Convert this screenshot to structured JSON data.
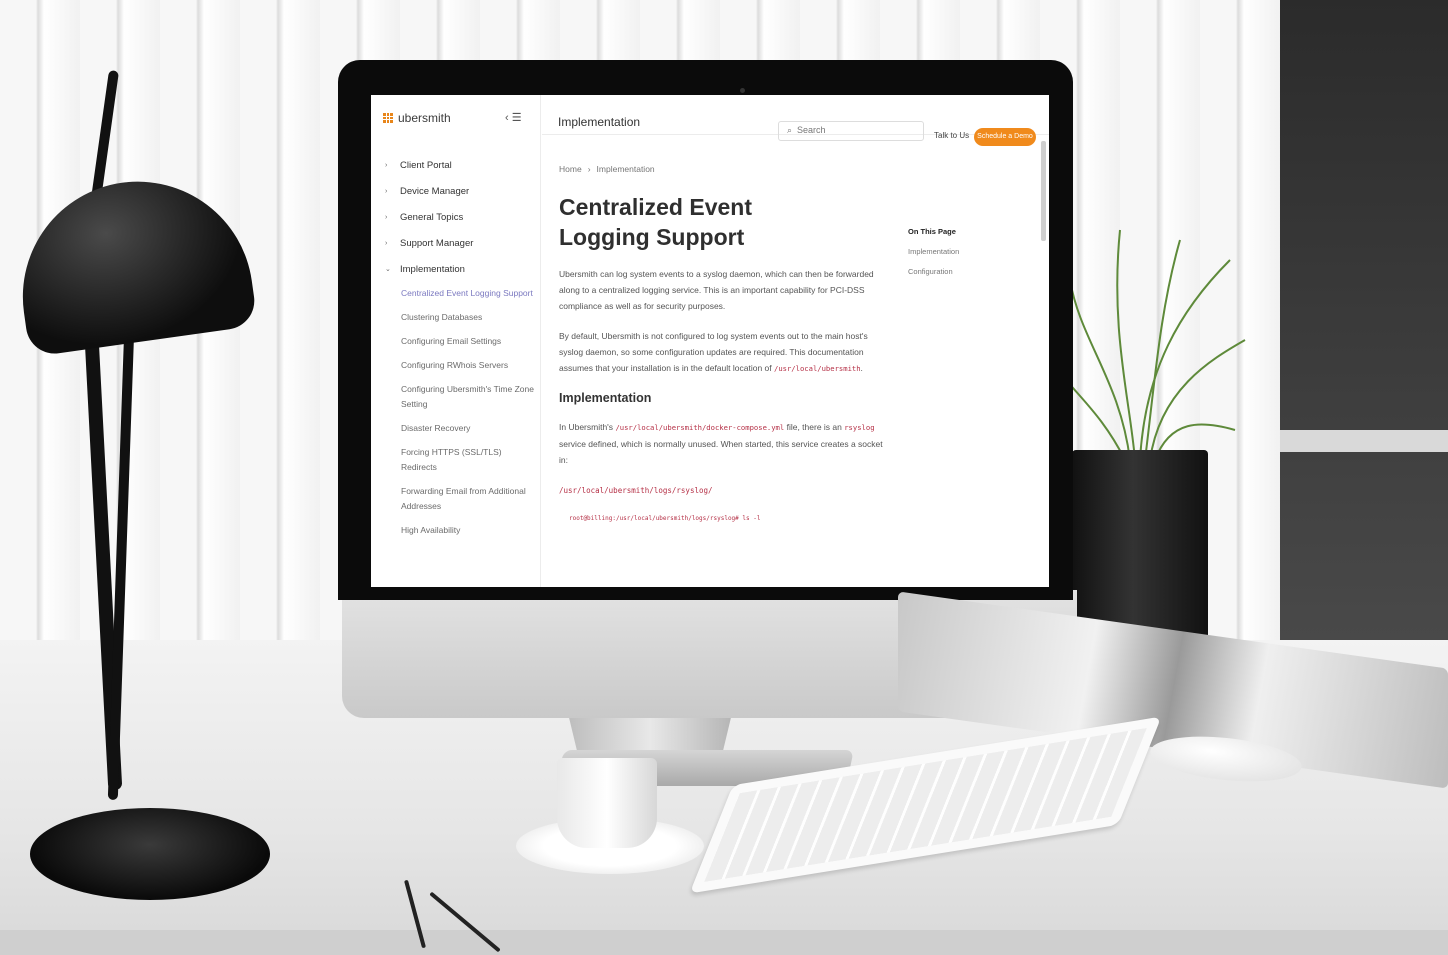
{
  "brand": {
    "name": "ubersmith"
  },
  "sidebar": {
    "collapse_label": "‹ ☰",
    "items": [
      {
        "label": "Client Portal",
        "expanded": false
      },
      {
        "label": "Device Manager",
        "expanded": false
      },
      {
        "label": "General Topics",
        "expanded": false
      },
      {
        "label": "Support Manager",
        "expanded": false
      },
      {
        "label": "Implementation",
        "expanded": true
      }
    ],
    "subitems": [
      {
        "label": "Centralized Event Logging Support",
        "active": true
      },
      {
        "label": "Clustering Databases"
      },
      {
        "label": "Configuring Email Settings"
      },
      {
        "label": "Configuring RWhois Servers"
      },
      {
        "label": "Configuring Ubersmith's Time Zone Setting"
      },
      {
        "label": "Disaster Recovery"
      },
      {
        "label": "Forcing HTTPS (SSL/TLS) Redirects"
      },
      {
        "label": "Forwarding Email from Additional Addresses"
      },
      {
        "label": "High Availability"
      }
    ]
  },
  "header": {
    "title": "Implementation",
    "search_placeholder": "Search",
    "talk_label": "Talk to Us",
    "demo_label": "Schedule a Demo"
  },
  "breadcrumb": {
    "home": "Home",
    "separator": "›",
    "current": "Implementation"
  },
  "article": {
    "title": "Centralized Event Logging Support",
    "p1": "Ubersmith can log system events to a syslog daemon, which can then be forwarded along to a centralized logging service. This is an important capability for PCI-DSS compliance as well as for security purposes.",
    "p2_text": "By default, Ubersmith is not configured to log system events out to the main host's syslog daemon, so some configuration updates are required. This documentation assumes that your installation is in the default location of",
    "p2_code": "/usr/local/ubersmith",
    "p2_end": ".",
    "section_heading": "Implementation",
    "p3_start": "In Ubersmith's",
    "p3_code": "/usr/local/ubersmith/docker-compose.yml",
    "p3_mid": "file, there is an",
    "p3_code2": "rsyslog",
    "p3_end": "service defined, which is normally unused. When started, this service creates a socket in:",
    "path_line": "/usr/local/ubersmith/logs/rsyslog/",
    "terminal_line": "root@billing:/usr/local/ubersmith/logs/rsyslog# ls -l"
  },
  "toc": {
    "title": "On This Page",
    "items": [
      "Implementation",
      "Configuration"
    ]
  },
  "colors": {
    "accent": "#f08a1c",
    "active_link": "#7b79c0",
    "code": "#b53046"
  },
  "icons": {
    "search": "search-icon",
    "menu": "menu-icon",
    "brand": "grid-logo-icon"
  }
}
